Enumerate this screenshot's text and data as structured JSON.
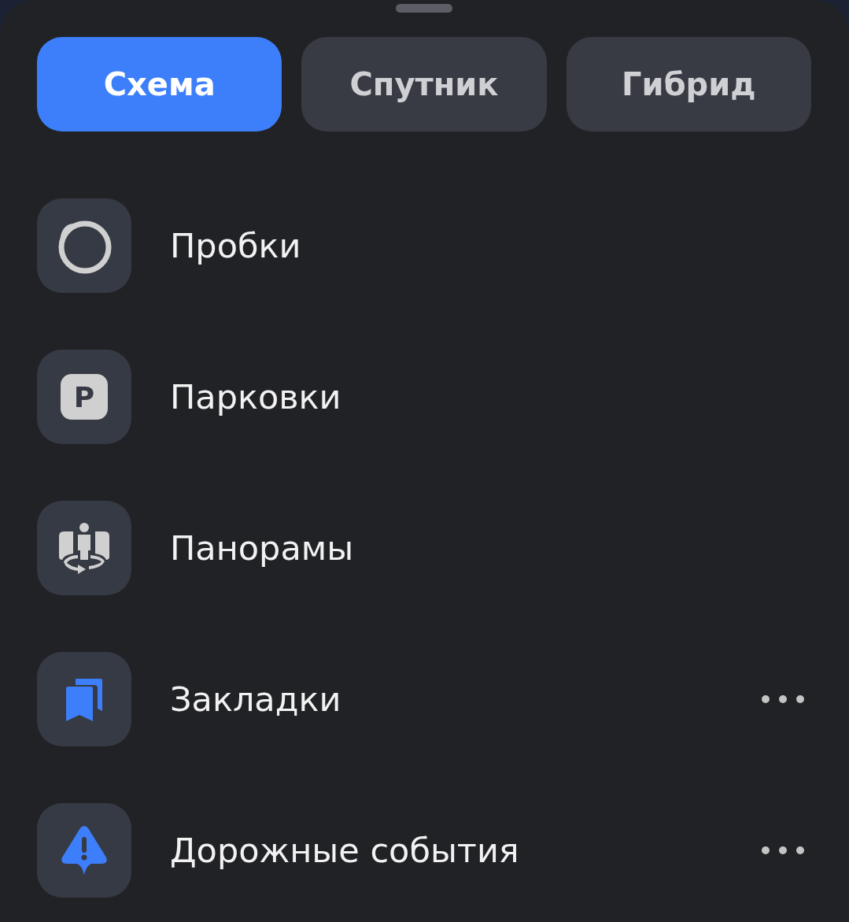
{
  "tabs": [
    {
      "label": "Схема",
      "selected": true
    },
    {
      "label": "Спутник",
      "selected": false
    },
    {
      "label": "Гибрид",
      "selected": false
    }
  ],
  "layers": [
    {
      "kind": "traffic",
      "label": "Пробки",
      "on": false,
      "menu": false
    },
    {
      "kind": "parking",
      "label": "Парковки",
      "icon_text": "P",
      "on": false,
      "menu": false
    },
    {
      "kind": "panorama",
      "label": "Панорамы",
      "on": false,
      "menu": false
    },
    {
      "kind": "bookmarks",
      "label": "Закладки",
      "on": true,
      "menu": true
    },
    {
      "kind": "events",
      "label": "Дорожные события",
      "on": true,
      "menu": true
    }
  ]
}
